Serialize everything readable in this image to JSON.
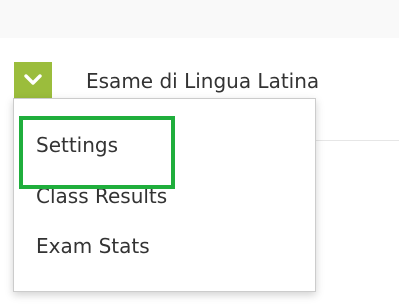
{
  "header": {
    "course_title": "Esame di Lingua Latina",
    "toggle_icon": "chevron-down-icon",
    "toggle_color": "#9bbd3c"
  },
  "menu": {
    "items": [
      {
        "label": "Settings"
      },
      {
        "label": "Class Results"
      },
      {
        "label": "Exam Stats"
      }
    ]
  },
  "annotation": {
    "highlight_color": "#1fae3c"
  }
}
